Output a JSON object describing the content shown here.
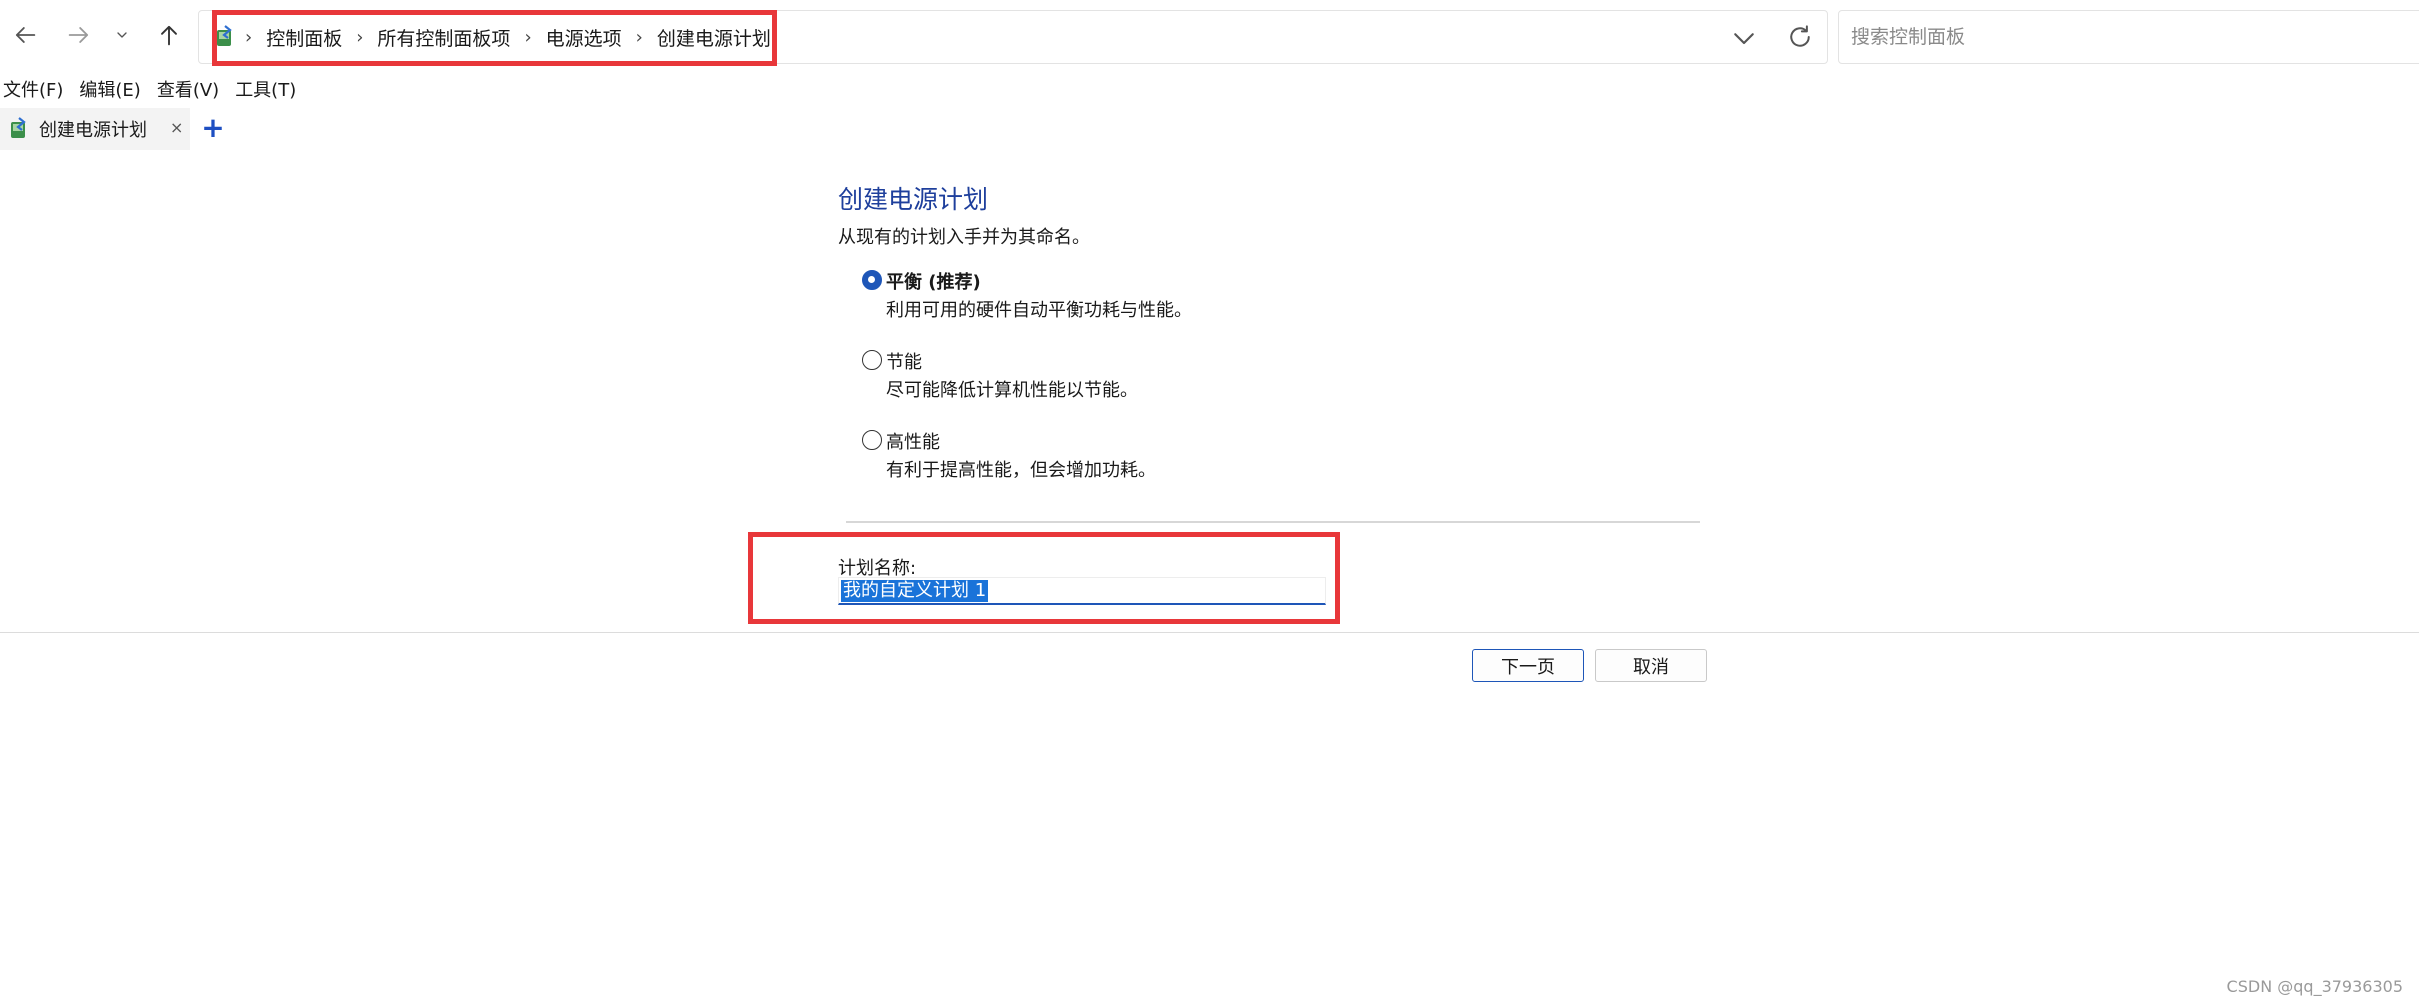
{
  "nav": {
    "back": "back-arrow",
    "forward": "forward-arrow",
    "recent": "chevron-down",
    "up": "up-arrow"
  },
  "breadcrumb": {
    "items": [
      "控制面板",
      "所有控制面板项",
      "电源选项",
      "创建电源计划"
    ],
    "separator": "›"
  },
  "search": {
    "placeholder": "搜索控制面板",
    "value": ""
  },
  "menu": {
    "items": [
      "文件(F)",
      "编辑(E)",
      "查看(V)",
      "工具(T)"
    ]
  },
  "tab": {
    "title": "创建电源计划",
    "close": "×",
    "add": "+"
  },
  "main": {
    "title": "创建电源计划",
    "description": "从现有的计划入手并为其命名。",
    "options": [
      {
        "label": "平衡 (推荐)",
        "desc": "利用可用的硬件自动平衡功耗与性能。",
        "selected": true
      },
      {
        "label": "节能",
        "desc": "尽可能降低计算机性能以节能。",
        "selected": false
      },
      {
        "label": "高性能",
        "desc": "有利于提高性能，但会增加功耗。",
        "selected": false
      }
    ],
    "name_label": "计划名称:",
    "name_value": "我的自定义计划 1"
  },
  "buttons": {
    "next": "下一页",
    "cancel": "取消"
  },
  "watermark": "CSDN @qq_37936305",
  "colors": {
    "accent": "#1e56b8",
    "title": "#1e3f9c",
    "highlight_box": "#e8373a",
    "selection": "#1a73d9"
  }
}
